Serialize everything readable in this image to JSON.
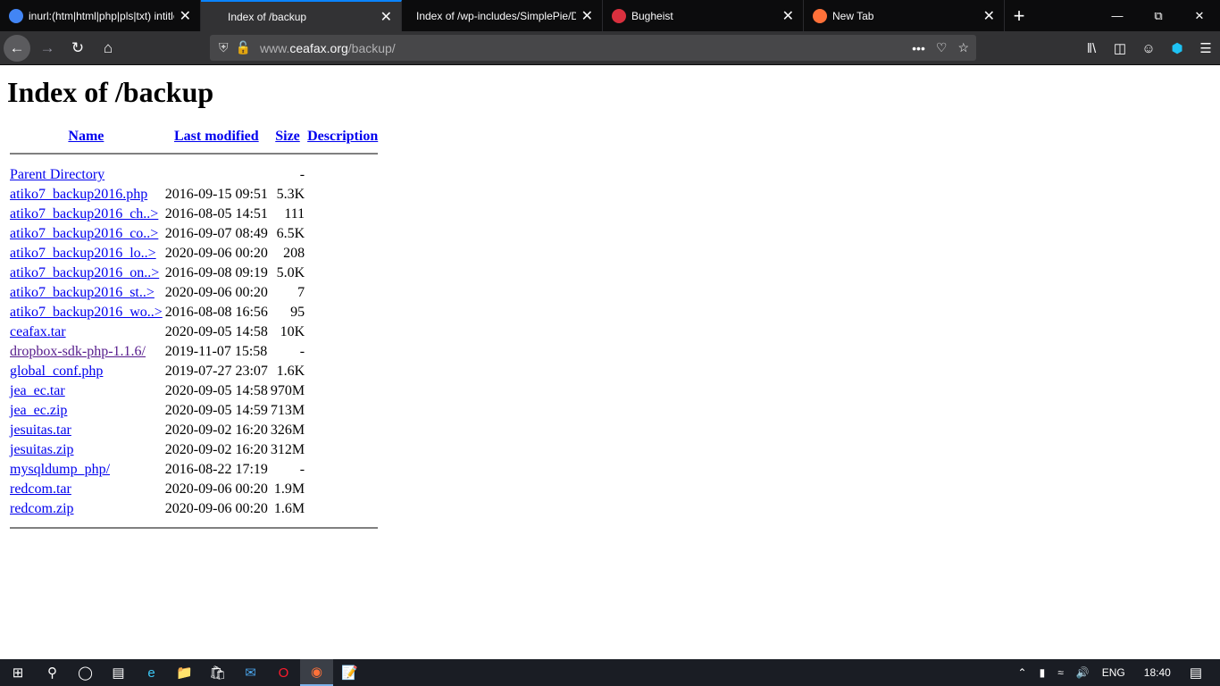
{
  "browser": {
    "tabs": [
      {
        "title": "inurl:(htm|html|php|pls|txt) intitle",
        "favicon": "google-icon",
        "color": "#4285f4"
      },
      {
        "title": "Index of /backup",
        "active": true
      },
      {
        "title": "Index of /wp-includes/SimplePie/D",
        "favicon": ""
      },
      {
        "title": "Bugheist",
        "favicon": "bugheist-icon",
        "color": "#d9303e"
      },
      {
        "title": "New Tab",
        "favicon": "firefox-icon",
        "color": "#ff7139"
      }
    ],
    "url_prefix": "www.",
    "url_domain": "ceafax.org",
    "url_path": "/backup/"
  },
  "page": {
    "title": "Index of /backup",
    "headers": {
      "name": "Name",
      "modified": "Last modified",
      "size": "Size",
      "description": "Description"
    },
    "rows": [
      {
        "name": "Parent Directory",
        "modified": "",
        "size": "-"
      },
      {
        "name": "atiko7_backup2016.php",
        "modified": "2016-09-15 09:51",
        "size": "5.3K"
      },
      {
        "name": "atiko7_backup2016_ch..>",
        "modified": "2016-08-05 14:51",
        "size": "111"
      },
      {
        "name": "atiko7_backup2016_co..>",
        "modified": "2016-09-07 08:49",
        "size": "6.5K"
      },
      {
        "name": "atiko7_backup2016_lo..>",
        "modified": "2020-09-06 00:20",
        "size": "208"
      },
      {
        "name": "atiko7_backup2016_on..>",
        "modified": "2016-09-08 09:19",
        "size": "5.0K"
      },
      {
        "name": "atiko7_backup2016_st..>",
        "modified": "2020-09-06 00:20",
        "size": "7"
      },
      {
        "name": "atiko7_backup2016_wo..>",
        "modified": "2016-08-08 16:56",
        "size": "95"
      },
      {
        "name": "ceafax.tar",
        "modified": "2020-09-05 14:58",
        "size": "10K"
      },
      {
        "name": "dropbox-sdk-php-1.1.6/",
        "modified": "2019-11-07 15:58",
        "size": "-",
        "visited": true
      },
      {
        "name": "global_conf.php",
        "modified": "2019-07-27 23:07",
        "size": "1.6K"
      },
      {
        "name": "jea_ec.tar",
        "modified": "2020-09-05 14:58",
        "size": "970M"
      },
      {
        "name": "jea_ec.zip",
        "modified": "2020-09-05 14:59",
        "size": "713M"
      },
      {
        "name": "jesuitas.tar",
        "modified": "2020-09-02 16:20",
        "size": "326M"
      },
      {
        "name": "jesuitas.zip",
        "modified": "2020-09-02 16:20",
        "size": "312M"
      },
      {
        "name": "mysqldump_php/",
        "modified": "2016-08-22 17:19",
        "size": "-"
      },
      {
        "name": "redcom.tar",
        "modified": "2020-09-06 00:20",
        "size": "1.9M"
      },
      {
        "name": "redcom.zip",
        "modified": "2020-09-06 00:20",
        "size": "1.6M"
      }
    ]
  },
  "taskbar": {
    "lang": "ENG",
    "time": "18:40"
  }
}
